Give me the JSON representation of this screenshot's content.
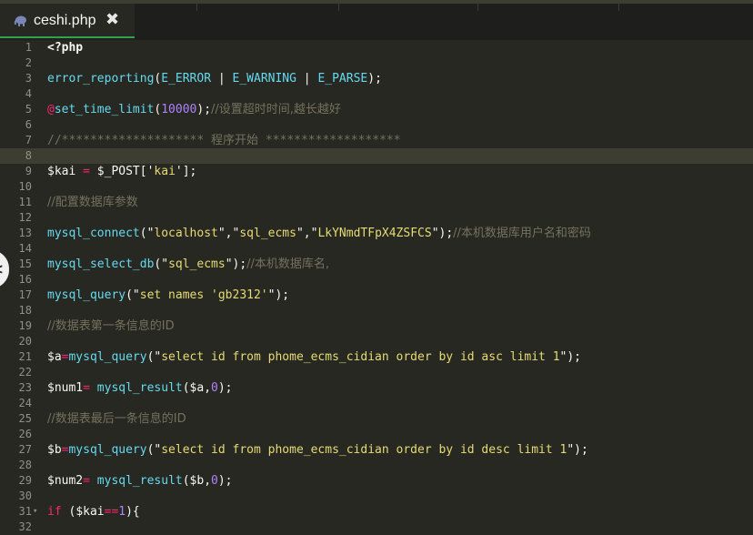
{
  "tab": {
    "filename": "ceshi.php",
    "close_glyph": "✖",
    "icon": "php-elephant-icon"
  },
  "colors": {
    "background": "#272822",
    "tab_active_border": "#2fa24b",
    "keyword": "#f92672",
    "function": "#66d9ef",
    "string": "#e6db74",
    "number": "#ae81ff",
    "comment": "#75715e"
  },
  "nav": {
    "left_arrow": "<"
  },
  "editor": {
    "current_line": 8,
    "lines": [
      {
        "n": "1",
        "fold": "",
        "tokens": [
          {
            "t": "<?php",
            "c": "va bold"
          }
        ]
      },
      {
        "n": "2",
        "fold": "",
        "tokens": []
      },
      {
        "n": "3",
        "fold": "",
        "tokens": [
          {
            "t": "error_reporting",
            "c": "fn"
          },
          {
            "t": "(",
            "c": "va"
          },
          {
            "t": "E_ERROR",
            "c": "fn"
          },
          {
            "t": " | ",
            "c": "va"
          },
          {
            "t": "E_WARNING",
            "c": "fn"
          },
          {
            "t": " | ",
            "c": "va"
          },
          {
            "t": "E_PARSE",
            "c": "fn"
          },
          {
            "t": ");",
            "c": "va"
          }
        ]
      },
      {
        "n": "4",
        "fold": "",
        "tokens": []
      },
      {
        "n": "5",
        "fold": "",
        "tokens": [
          {
            "t": "@",
            "c": "kw"
          },
          {
            "t": "set_time_limit",
            "c": "fn"
          },
          {
            "t": "(",
            "c": "va"
          },
          {
            "t": "10000",
            "c": "nu"
          },
          {
            "t": ");",
            "c": "va"
          },
          {
            "t": "//设置超时时间,越长越好",
            "c": "cm cmcjk"
          }
        ]
      },
      {
        "n": "6",
        "fold": "",
        "tokens": []
      },
      {
        "n": "7",
        "fold": "",
        "tokens": [
          {
            "t": "//******************** 程序开始 *******************",
            "c": "cm"
          }
        ]
      },
      {
        "n": "8",
        "fold": "",
        "tokens": []
      },
      {
        "n": "9",
        "fold": "",
        "tokens": [
          {
            "t": "$kai",
            "c": "va"
          },
          {
            "t": " = ",
            "c": "kw"
          },
          {
            "t": "$_POST",
            "c": "va"
          },
          {
            "t": "['",
            "c": "va"
          },
          {
            "t": "kai",
            "c": "st"
          },
          {
            "t": "'];",
            "c": "va"
          }
        ]
      },
      {
        "n": "10",
        "fold": "",
        "tokens": []
      },
      {
        "n": "11",
        "fold": "",
        "tokens": [
          {
            "t": "//配置数据库参数",
            "c": "cm cmcjk"
          }
        ]
      },
      {
        "n": "12",
        "fold": "",
        "tokens": []
      },
      {
        "n": "13",
        "fold": "",
        "tokens": [
          {
            "t": "mysql_connect",
            "c": "fn"
          },
          {
            "t": "(\"",
            "c": "va"
          },
          {
            "t": "localhost",
            "c": "st"
          },
          {
            "t": "\",\"",
            "c": "va"
          },
          {
            "t": "sql_ecms",
            "c": "st"
          },
          {
            "t": "\",\"",
            "c": "va"
          },
          {
            "t": "LkYNmdTFpX4ZSFCS",
            "c": "st"
          },
          {
            "t": "\");",
            "c": "va"
          },
          {
            "t": "//本机数据库用户名和密码",
            "c": "cm cmcjk"
          }
        ]
      },
      {
        "n": "14",
        "fold": "",
        "tokens": []
      },
      {
        "n": "15",
        "fold": "",
        "tokens": [
          {
            "t": "mysql_select_db",
            "c": "fn"
          },
          {
            "t": "(\"",
            "c": "va"
          },
          {
            "t": "sql_ecms",
            "c": "st"
          },
          {
            "t": "\");",
            "c": "va"
          },
          {
            "t": "//本机数据库名,",
            "c": "cm cmcjk"
          }
        ]
      },
      {
        "n": "16",
        "fold": "",
        "tokens": []
      },
      {
        "n": "17",
        "fold": "",
        "tokens": [
          {
            "t": "mysql_query",
            "c": "fn"
          },
          {
            "t": "(\"",
            "c": "va"
          },
          {
            "t": "set names 'gb2312'",
            "c": "st"
          },
          {
            "t": "\");",
            "c": "va"
          }
        ]
      },
      {
        "n": "18",
        "fold": "",
        "tokens": []
      },
      {
        "n": "19",
        "fold": "",
        "tokens": [
          {
            "t": "//数据表第一条信息的ID",
            "c": "cm cmcjk"
          }
        ]
      },
      {
        "n": "20",
        "fold": "",
        "tokens": []
      },
      {
        "n": "21",
        "fold": "",
        "tokens": [
          {
            "t": "$a",
            "c": "va"
          },
          {
            "t": "=",
            "c": "kw"
          },
          {
            "t": "mysql_query",
            "c": "fn"
          },
          {
            "t": "(\"",
            "c": "va"
          },
          {
            "t": "select id from phome_ecms_cidian order by id asc limit 1",
            "c": "st"
          },
          {
            "t": "\");",
            "c": "va"
          }
        ]
      },
      {
        "n": "22",
        "fold": "",
        "tokens": []
      },
      {
        "n": "23",
        "fold": "",
        "tokens": [
          {
            "t": "$num1",
            "c": "va"
          },
          {
            "t": "= ",
            "c": "kw"
          },
          {
            "t": "mysql_result",
            "c": "fn"
          },
          {
            "t": "(",
            "c": "va"
          },
          {
            "t": "$a",
            "c": "va"
          },
          {
            "t": ",",
            "c": "va"
          },
          {
            "t": "0",
            "c": "nu"
          },
          {
            "t": ");",
            "c": "va"
          }
        ]
      },
      {
        "n": "24",
        "fold": "",
        "tokens": []
      },
      {
        "n": "25",
        "fold": "",
        "tokens": [
          {
            "t": "//数据表最后一条信息的ID",
            "c": "cm cmcjk"
          }
        ]
      },
      {
        "n": "26",
        "fold": "",
        "tokens": []
      },
      {
        "n": "27",
        "fold": "",
        "tokens": [
          {
            "t": "$b",
            "c": "va"
          },
          {
            "t": "=",
            "c": "kw"
          },
          {
            "t": "mysql_query",
            "c": "fn"
          },
          {
            "t": "(\"",
            "c": "va"
          },
          {
            "t": "select id from phome_ecms_cidian order by id desc limit 1",
            "c": "st"
          },
          {
            "t": "\");",
            "c": "va"
          }
        ]
      },
      {
        "n": "28",
        "fold": "",
        "tokens": []
      },
      {
        "n": "29",
        "fold": "",
        "tokens": [
          {
            "t": "$num2",
            "c": "va"
          },
          {
            "t": "= ",
            "c": "kw"
          },
          {
            "t": "mysql_result",
            "c": "fn"
          },
          {
            "t": "(",
            "c": "va"
          },
          {
            "t": "$b",
            "c": "va"
          },
          {
            "t": ",",
            "c": "va"
          },
          {
            "t": "0",
            "c": "nu"
          },
          {
            "t": ");",
            "c": "va"
          }
        ]
      },
      {
        "n": "30",
        "fold": "",
        "tokens": []
      },
      {
        "n": "31",
        "fold": "▾",
        "tokens": [
          {
            "t": "if",
            "c": "kw"
          },
          {
            "t": " (",
            "c": "va"
          },
          {
            "t": "$kai",
            "c": "va"
          },
          {
            "t": "==",
            "c": "kw"
          },
          {
            "t": "1",
            "c": "nu"
          },
          {
            "t": "){",
            "c": "va"
          }
        ]
      },
      {
        "n": "32",
        "fold": "",
        "tokens": []
      }
    ]
  }
}
